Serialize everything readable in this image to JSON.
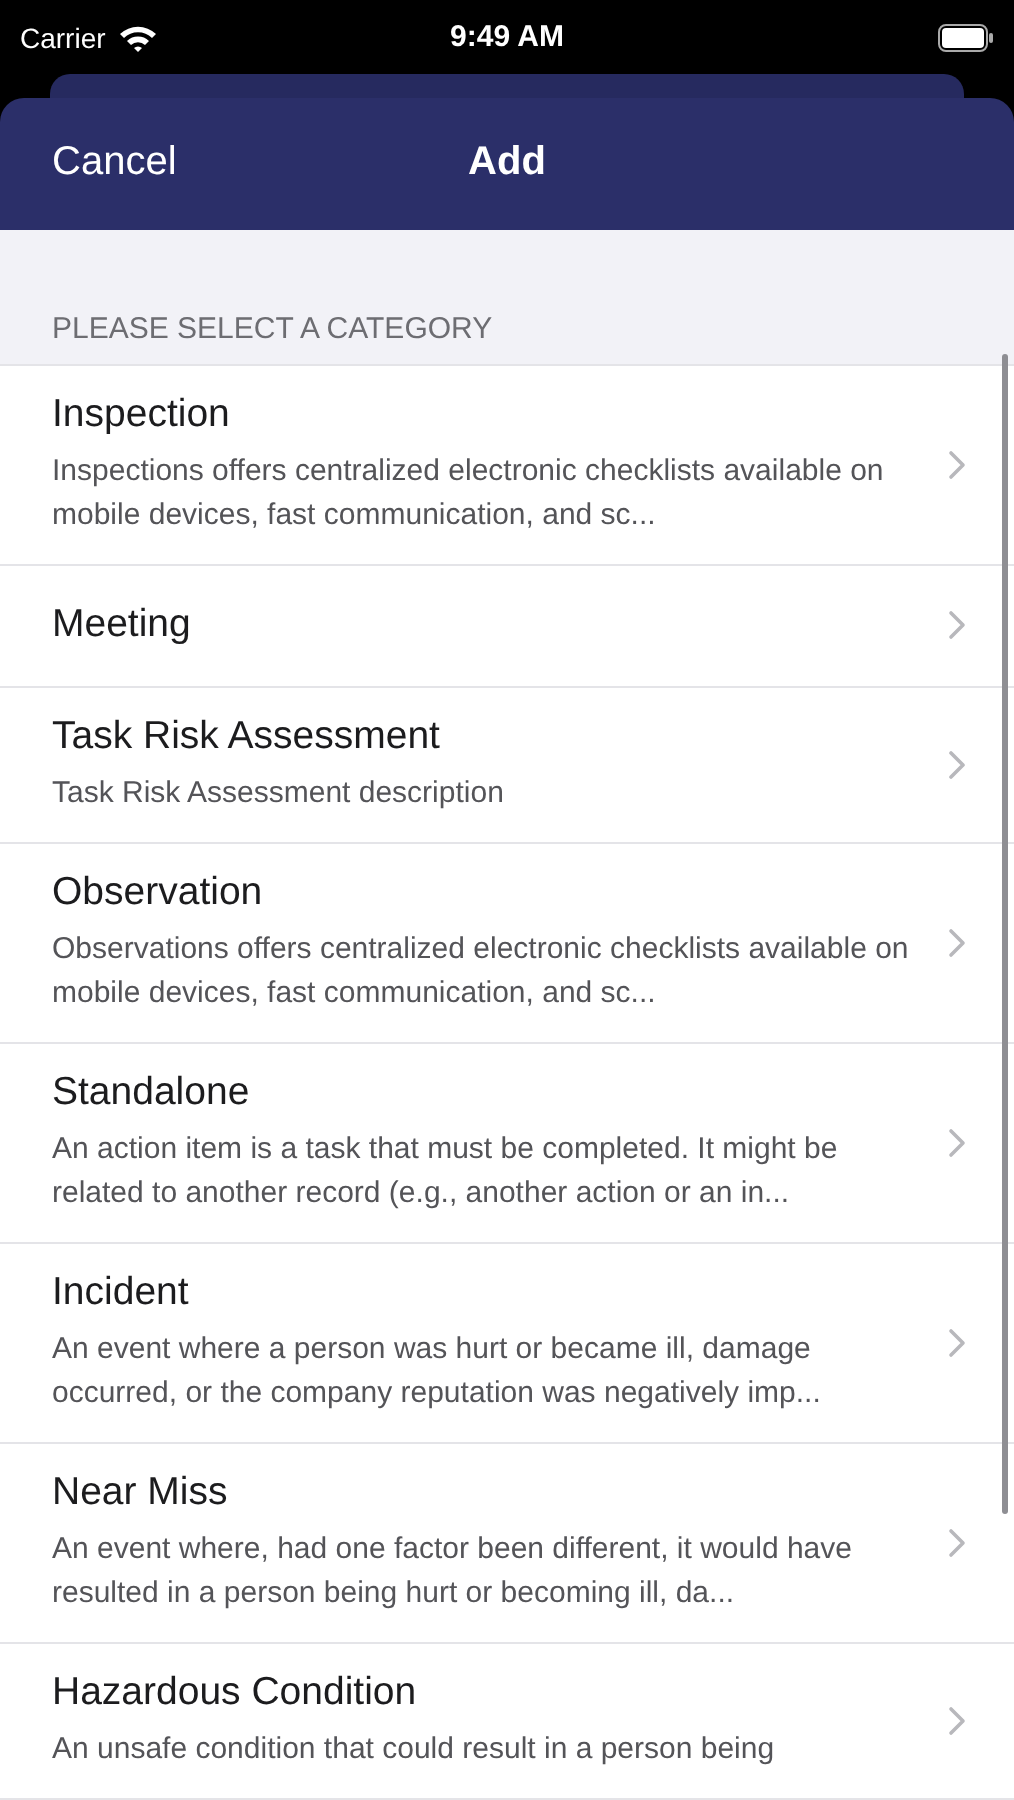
{
  "status_bar": {
    "carrier": "Carrier",
    "time": "9:49 AM"
  },
  "nav_bar": {
    "cancel": "Cancel",
    "title": "Add"
  },
  "section_header": "PLEASE SELECT A CATEGORY",
  "categories": [
    {
      "title": "Inspection",
      "description": "Inspections offers centralized electronic checklists available on mobile devices, fast communication, and sc..."
    },
    {
      "title": "Meeting"
    },
    {
      "title": "Task Risk Assessment",
      "description": "Task Risk Assessment description"
    },
    {
      "title": "Observation",
      "description": "Observations offers centralized electronic checklists available on mobile devices, fast communication, and sc..."
    },
    {
      "title": "Standalone",
      "description": "An action item is a task that must be completed. It might be related to another record (e.g., another action or an in..."
    },
    {
      "title": "Incident",
      "description": "An event where a person was hurt or became ill, damage occurred, or the company reputation was negatively imp..."
    },
    {
      "title": "Near Miss",
      "description": "An event where, had one factor been different, it would have resulted in  a person being hurt or becoming ill, da..."
    },
    {
      "title": "Hazardous Condition",
      "description": "An unsafe condition that could result in a person being"
    }
  ]
}
